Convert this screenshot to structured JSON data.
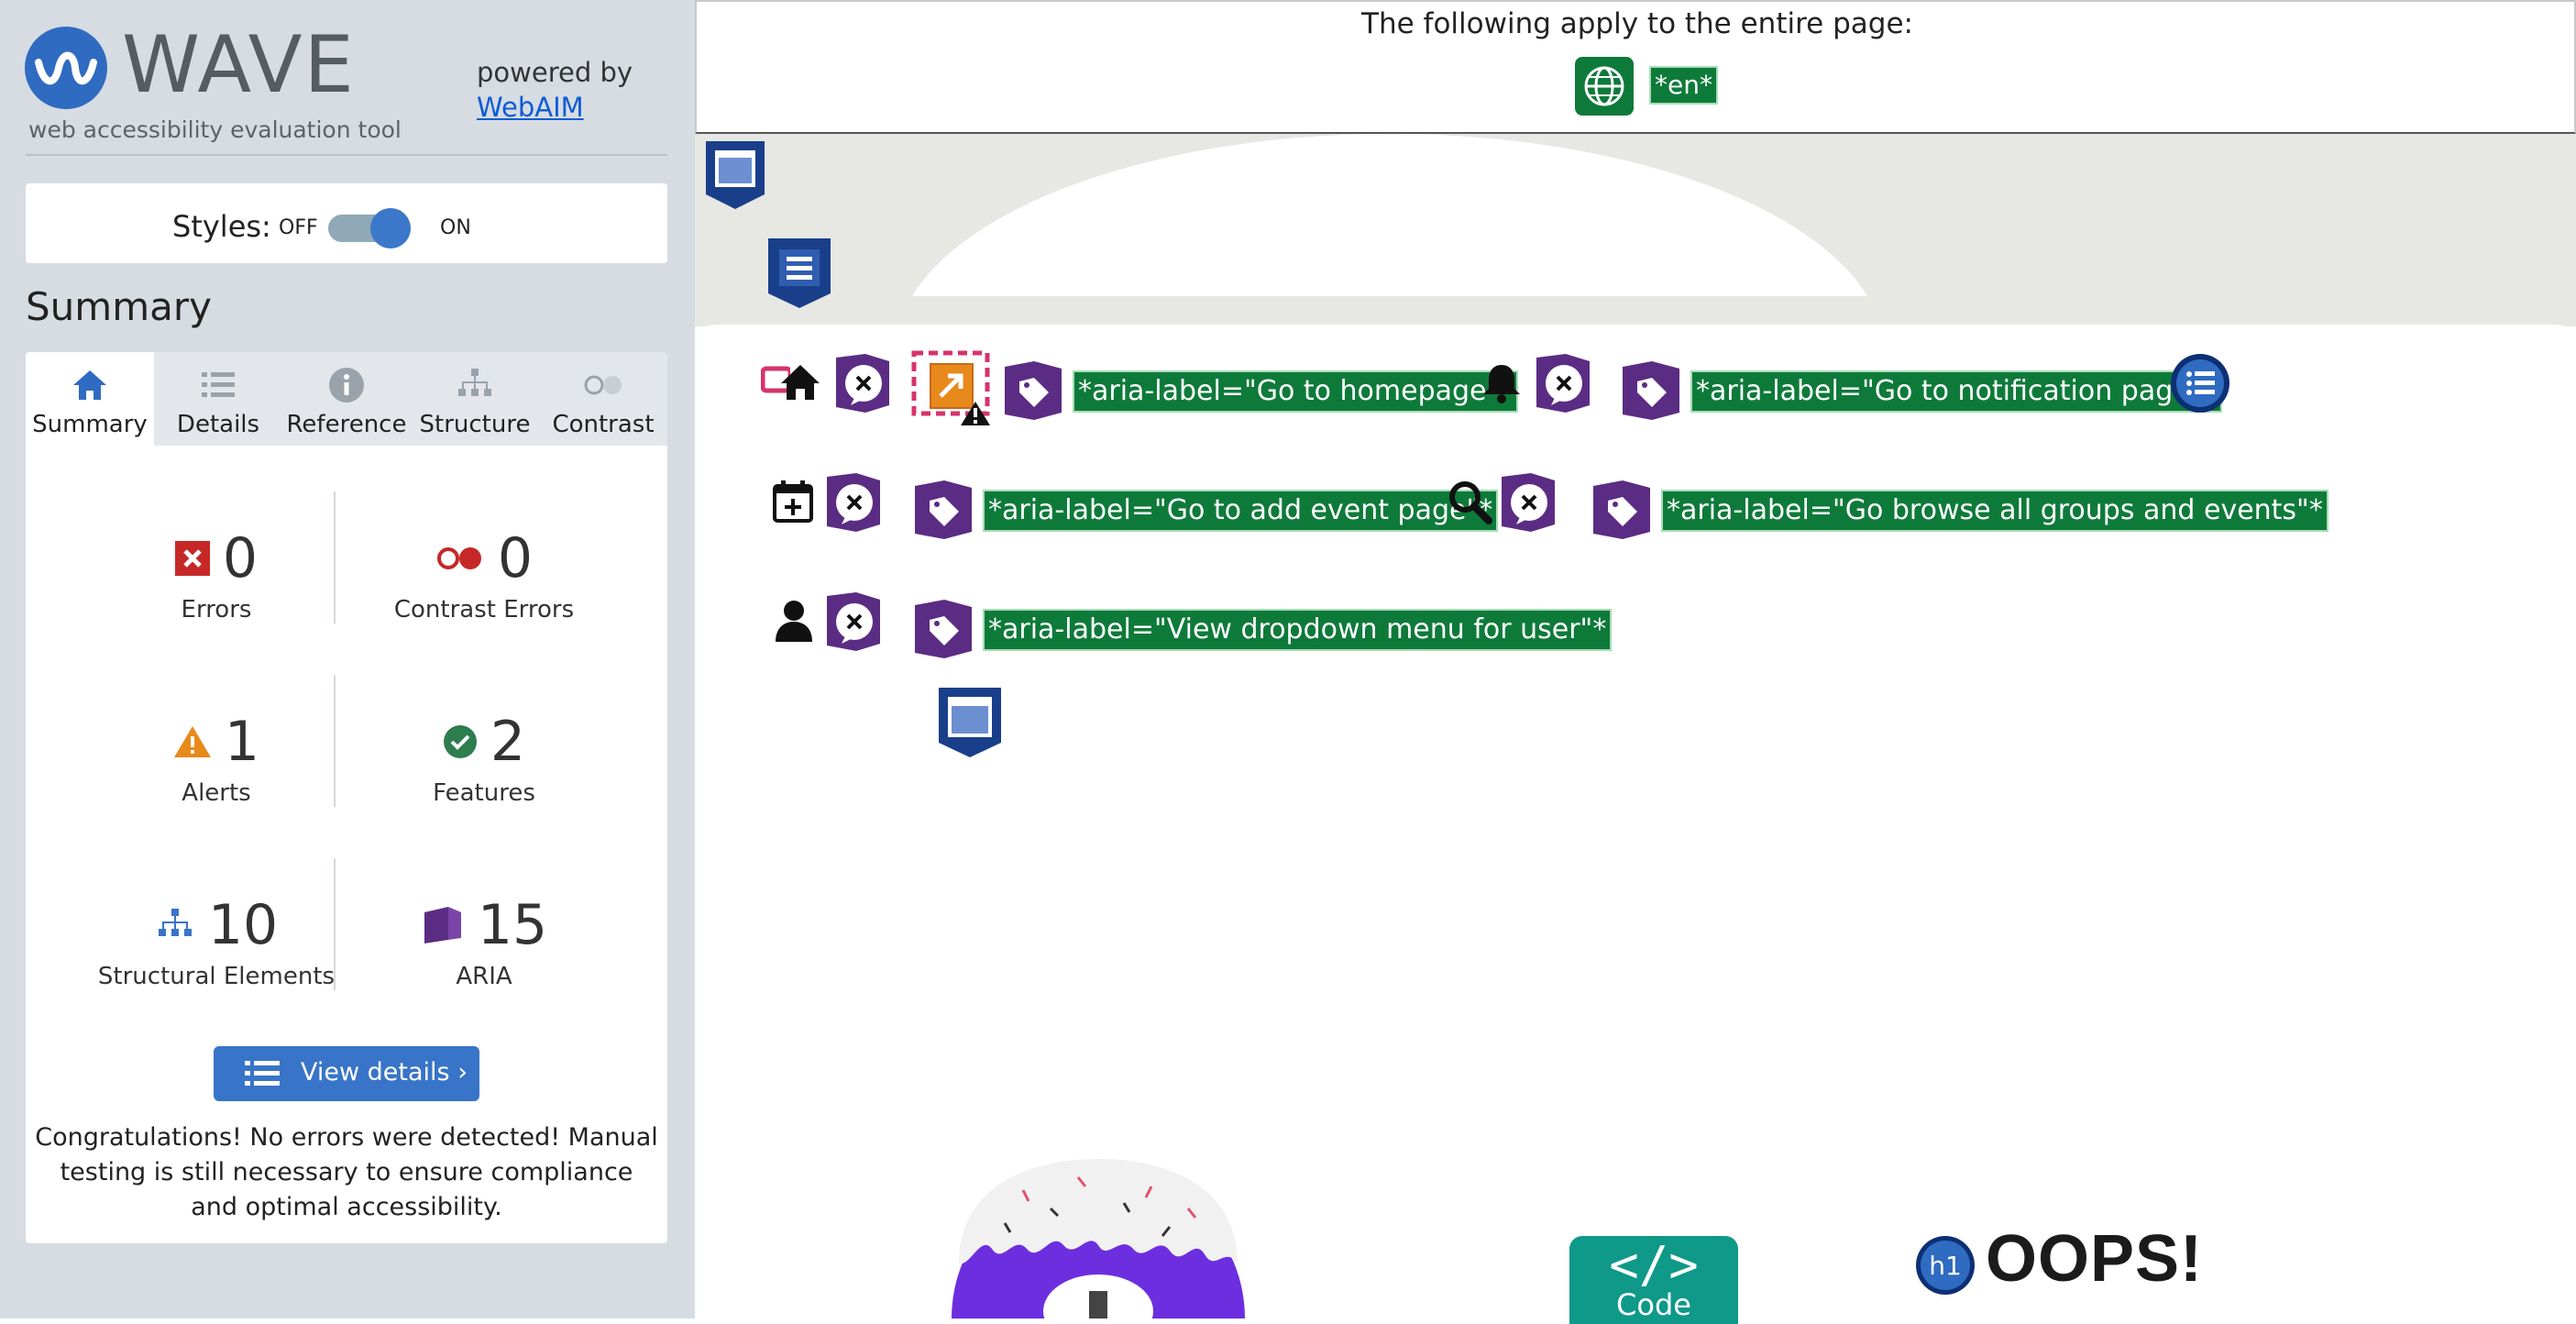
{
  "sidebar": {
    "brand": {
      "name": "WAVE",
      "tagline": "web accessibility evaluation tool",
      "powered_by": "powered by",
      "powered_link": "WebAIM"
    },
    "styles": {
      "label": "Styles:",
      "off": "OFF",
      "on": "ON",
      "state": "on"
    },
    "summary_title": "Summary",
    "tabs": [
      {
        "label": "Summary",
        "icon": "home-icon",
        "active": true
      },
      {
        "label": "Details",
        "icon": "list-icon",
        "active": false
      },
      {
        "label": "Reference",
        "icon": "info-icon",
        "active": false
      },
      {
        "label": "Structure",
        "icon": "structure-icon",
        "active": false
      },
      {
        "label": "Contrast",
        "icon": "contrast-icon",
        "active": false
      }
    ],
    "stats": {
      "errors": {
        "count": "0",
        "label": "Errors"
      },
      "contrast_errors": {
        "count": "0",
        "label": "Contrast Errors"
      },
      "alerts": {
        "count": "1",
        "label": "Alerts"
      },
      "features": {
        "count": "2",
        "label": "Features"
      },
      "structural": {
        "count": "10",
        "label": "Structural Elements"
      },
      "aria": {
        "count": "15",
        "label": "ARIA"
      }
    },
    "view_details": "View details ›",
    "congrats": "Congratulations! No errors were detected! Manual testing is still necessary to ensure compliance and optimal accessibility."
  },
  "main": {
    "page_notice": "The following apply to the entire page:",
    "lang_tag": "*en*",
    "aria_labels": {
      "home": "*aria-label=\"Go to homepage\"*",
      "notification": "*aria-label=\"Go to notification page\"*",
      "add_event": "*aria-label=\"Go to add event page\"*",
      "browse": "*aria-label=\"Go browse all groups and events\"*",
      "user_menu": "*aria-label=\"View dropdown menu for user\"*"
    },
    "heading_badge": "h1",
    "oops": "OOPS!",
    "code_tab": {
      "symbol": "</>",
      "label": "Code"
    }
  },
  "colors": {
    "sidebar_bg": "#d6dce2",
    "accent_blue": "#3874c7",
    "error_red": "#c62828",
    "alert_orange": "#e8891c",
    "feature_green": "#2e7d4f",
    "aria_purple": "#5b2c83",
    "aria_label_green": "#0e7a3a",
    "structure_navy": "#1a3f8a"
  }
}
